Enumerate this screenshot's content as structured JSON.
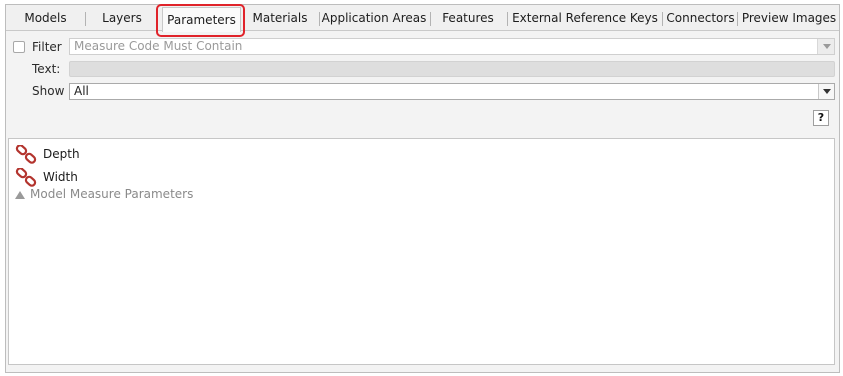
{
  "tabs": [
    {
      "label": "Models"
    },
    {
      "label": "Layers"
    },
    {
      "label": "Parameters",
      "active": true
    },
    {
      "label": "Materials"
    },
    {
      "label": "Application Areas"
    },
    {
      "label": "Features"
    },
    {
      "label": "External Reference Keys"
    },
    {
      "label": "Connectors"
    },
    {
      "label": "Preview Images"
    }
  ],
  "filter": {
    "checkbox_label": "Filter",
    "checked": false,
    "selected": "Measure Code Must Contain",
    "text_label": "Text:",
    "text_value": ""
  },
  "show": {
    "label": "Show",
    "selected": "All"
  },
  "help_label": "?",
  "parameters": [
    {
      "label": "Depth",
      "icon": "chain-link-icon"
    },
    {
      "label": "Width",
      "icon": "chain-link-icon"
    }
  ],
  "group": {
    "label": "Model Measure Parameters",
    "icon": "collapse-triangle-icon"
  },
  "colors": {
    "highlight": "#e0232a",
    "link_icon": "#b3342e"
  }
}
